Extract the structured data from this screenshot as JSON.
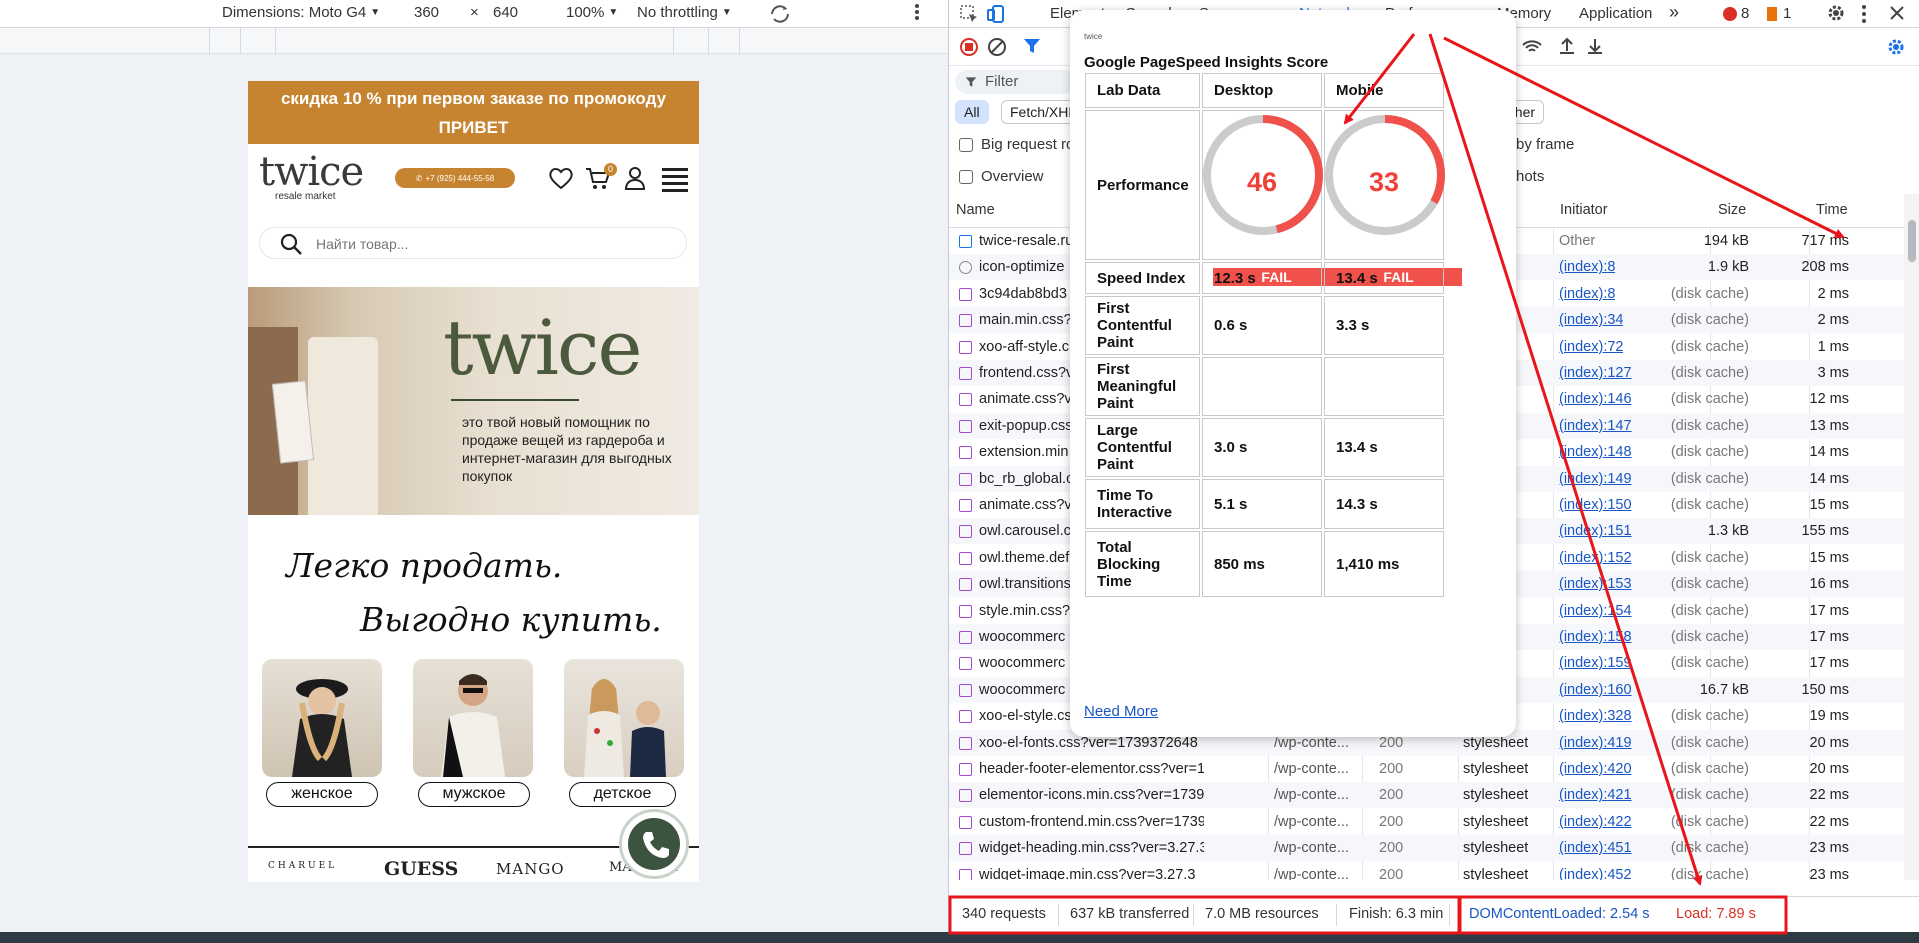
{
  "device_toolbar": {
    "dimensions_label": "Dimensions: Moto G4",
    "width": "360",
    "times": "×",
    "height": "640",
    "zoom": "100%",
    "throttling": "No throttling"
  },
  "site": {
    "promo_line1": "скидка 10 % при первом заказе по промокоду",
    "promo_line2": "ПРИВЕТ",
    "logo": "twice",
    "logo_sub": "resale market",
    "phone": "+7 (925) 444-55-58",
    "cart_count": "0",
    "search_placeholder": "Найти товар...",
    "hero_brand": "twice",
    "hero_text": "это твой новый помощник по продаже вещей из гардероба и интернет-магазин для выгодных покупок",
    "slogan_line1": "Легко продать.",
    "slogan_line2": "Выгодно купить.",
    "categories": [
      "женское",
      "мужское",
      "детское"
    ],
    "brands": [
      "CHARUEL",
      "GUESS",
      "MANGO",
      "MARELLA"
    ]
  },
  "devtools": {
    "tabs": [
      "Elements",
      "Console",
      "Sources",
      "Network",
      "Performance",
      "Memory",
      "Application"
    ],
    "more": "»",
    "errors": "8",
    "warnings": "1",
    "filter_placeholder": "Filter",
    "types": [
      "All",
      "Fetch/XHR",
      "Other"
    ],
    "options": {
      "big_request_rows": "Big request ro",
      "overview": "Overview",
      "group_by_frame": "by frame",
      "screenshots": "hots"
    },
    "columns": [
      "Name",
      "Initiator",
      "Size",
      "Time"
    ],
    "rows": [
      {
        "name": "twice-resale.ru",
        "path": "",
        "status": "",
        "type": "ent",
        "initiator": "Other",
        "size": "194 kB",
        "time": "717 ms"
      },
      {
        "name": "icon-optimize",
        "path": "",
        "status": "",
        "type": "",
        "initiator": "(index):8",
        "size": "1.9 kB",
        "time": "208 ms"
      },
      {
        "name": "3c94dab8bd3",
        "path": "",
        "status": "",
        "type": "heet",
        "initiator": "(index):8",
        "size": "(disk cache)",
        "time": "2 ms"
      },
      {
        "name": "main.min.css?",
        "path": "",
        "status": "",
        "type": "heet",
        "initiator": "(index):34",
        "size": "(disk cache)",
        "time": "2 ms"
      },
      {
        "name": "xoo-aff-style.c",
        "path": "",
        "status": "",
        "type": "heet",
        "initiator": "(index):72",
        "size": "(disk cache)",
        "time": "1 ms"
      },
      {
        "name": "frontend.css?v",
        "path": "",
        "status": "",
        "type": "heet",
        "initiator": "(index):127",
        "size": "(disk cache)",
        "time": "3 ms"
      },
      {
        "name": "animate.css?v",
        "path": "",
        "status": "",
        "type": "heet",
        "initiator": "(index):146",
        "size": "(disk cache)",
        "time": "12 ms"
      },
      {
        "name": "exit-popup.css",
        "path": "",
        "status": "",
        "type": "heet",
        "initiator": "(index):147",
        "size": "(disk cache)",
        "time": "13 ms"
      },
      {
        "name": "extension.min",
        "path": "",
        "status": "",
        "type": "heet",
        "initiator": "(index):148",
        "size": "(disk cache)",
        "time": "14 ms"
      },
      {
        "name": "bc_rb_global.c",
        "path": "",
        "status": "",
        "type": "heet",
        "initiator": "(index):149",
        "size": "(disk cache)",
        "time": "14 ms"
      },
      {
        "name": "animate.css?v",
        "path": "",
        "status": "",
        "type": "heet",
        "initiator": "(index):150",
        "size": "(disk cache)",
        "time": "15 ms"
      },
      {
        "name": "owl.carousel.c",
        "path": "",
        "status": "",
        "type": "heet",
        "initiator": "(index):151",
        "size": "1.3 kB",
        "time": "155 ms"
      },
      {
        "name": "owl.theme.def",
        "path": "",
        "status": "",
        "type": "heet",
        "initiator": "(index):152",
        "size": "(disk cache)",
        "time": "15 ms"
      },
      {
        "name": "owl.transitions",
        "path": "",
        "status": "",
        "type": "heet",
        "initiator": "(index):153",
        "size": "(disk cache)",
        "time": "16 ms"
      },
      {
        "name": "style.min.css?",
        "path": "",
        "status": "",
        "type": "heet",
        "initiator": "(index):154",
        "size": "(disk cache)",
        "time": "17 ms"
      },
      {
        "name": "woocommerc",
        "path": "",
        "status": "",
        "type": "heet",
        "initiator": "(index):158",
        "size": "(disk cache)",
        "time": "17 ms"
      },
      {
        "name": "woocommerc",
        "path": "",
        "status": "",
        "type": "heet",
        "initiator": "(index):159",
        "size": "(disk cache)",
        "time": "17 ms"
      },
      {
        "name": "woocommerc",
        "path": "",
        "status": "",
        "type": "heet",
        "initiator": "(index):160",
        "size": "16.7 kB",
        "time": "150 ms"
      },
      {
        "name": "xoo-el-style.cs",
        "path": "",
        "status": "",
        "type": "heet",
        "initiator": "(index):328",
        "size": "(disk cache)",
        "time": "19 ms"
      },
      {
        "name": "xoo-el-fonts.css?ver=1739372648",
        "path": "/wp-conte...",
        "status": "200",
        "type": "stylesheet",
        "initiator": "(index):419",
        "size": "(disk cache)",
        "time": "20 ms"
      },
      {
        "name": "header-footer-elementor.css?ver=17393...",
        "path": "/wp-conte...",
        "status": "200",
        "type": "stylesheet",
        "initiator": "(index):420",
        "size": "(disk cache)",
        "time": "20 ms"
      },
      {
        "name": "elementor-icons.min.css?ver=1739372648",
        "path": "/wp-conte...",
        "status": "200",
        "type": "stylesheet",
        "initiator": "(index):421",
        "size": "(disk cache)",
        "time": "22 ms"
      },
      {
        "name": "custom-frontend.min.css?ver=1739380936",
        "path": "/wp-conte...",
        "status": "200",
        "type": "stylesheet",
        "initiator": "(index):422",
        "size": "(disk cache)",
        "time": "22 ms"
      },
      {
        "name": "widget-heading.min.css?ver=3.27.3",
        "path": "/wp-conte...",
        "status": "200",
        "type": "stylesheet",
        "initiator": "(index):451",
        "size": "(disk cache)",
        "time": "23 ms"
      },
      {
        "name": "widget-image.min.css?ver=3.27.3",
        "path": "/wp-conte...",
        "status": "200",
        "type": "stylesheet",
        "initiator": "(index):452",
        "size": "(disk cache)",
        "time": "23 ms"
      }
    ],
    "status_bar": {
      "requests": "340 requests",
      "transferred": "637 kB transferred",
      "resources": "7.0 MB resources",
      "finish": "Finish: 6.3 min",
      "dom_content_loaded": "DOMContentLoaded: 2.54 s",
      "load": "Load: 7.89 s"
    }
  },
  "psi": {
    "logo": "twice",
    "title": "Google PageSpeed Insights Score",
    "header": [
      "Lab Data",
      "Desktop",
      "Mobile"
    ],
    "performance_label": "Performance",
    "desktop_score": 46,
    "mobile_score": 33,
    "desktop_score_text": "46",
    "mobile_score_text": "33",
    "fail_label": "FAIL",
    "metrics": [
      {
        "label": "Speed Index",
        "desktop": "12.3 s",
        "mobile": "13.4 s"
      },
      {
        "label": "First Contentful Paint",
        "desktop": "0.6 s",
        "mobile": "3.3 s"
      },
      {
        "label": "First Meaningful Paint",
        "desktop": "",
        "mobile": ""
      },
      {
        "label": "Large Contentful Paint",
        "desktop": "3.0 s",
        "mobile": "13.4 s"
      },
      {
        "label": "Time To Interactive",
        "desktop": "5.1 s",
        "mobile": "14.3 s"
      },
      {
        "label": "Total Blocking Time",
        "desktop": "850 ms",
        "mobile": "1,410 ms"
      }
    ],
    "need_more": "Need More"
  },
  "colors": {
    "brand": "#c68431",
    "annotation_red": "#e8151b",
    "fail_red": "#f0514b",
    "link_blue": "#1a56c4"
  }
}
